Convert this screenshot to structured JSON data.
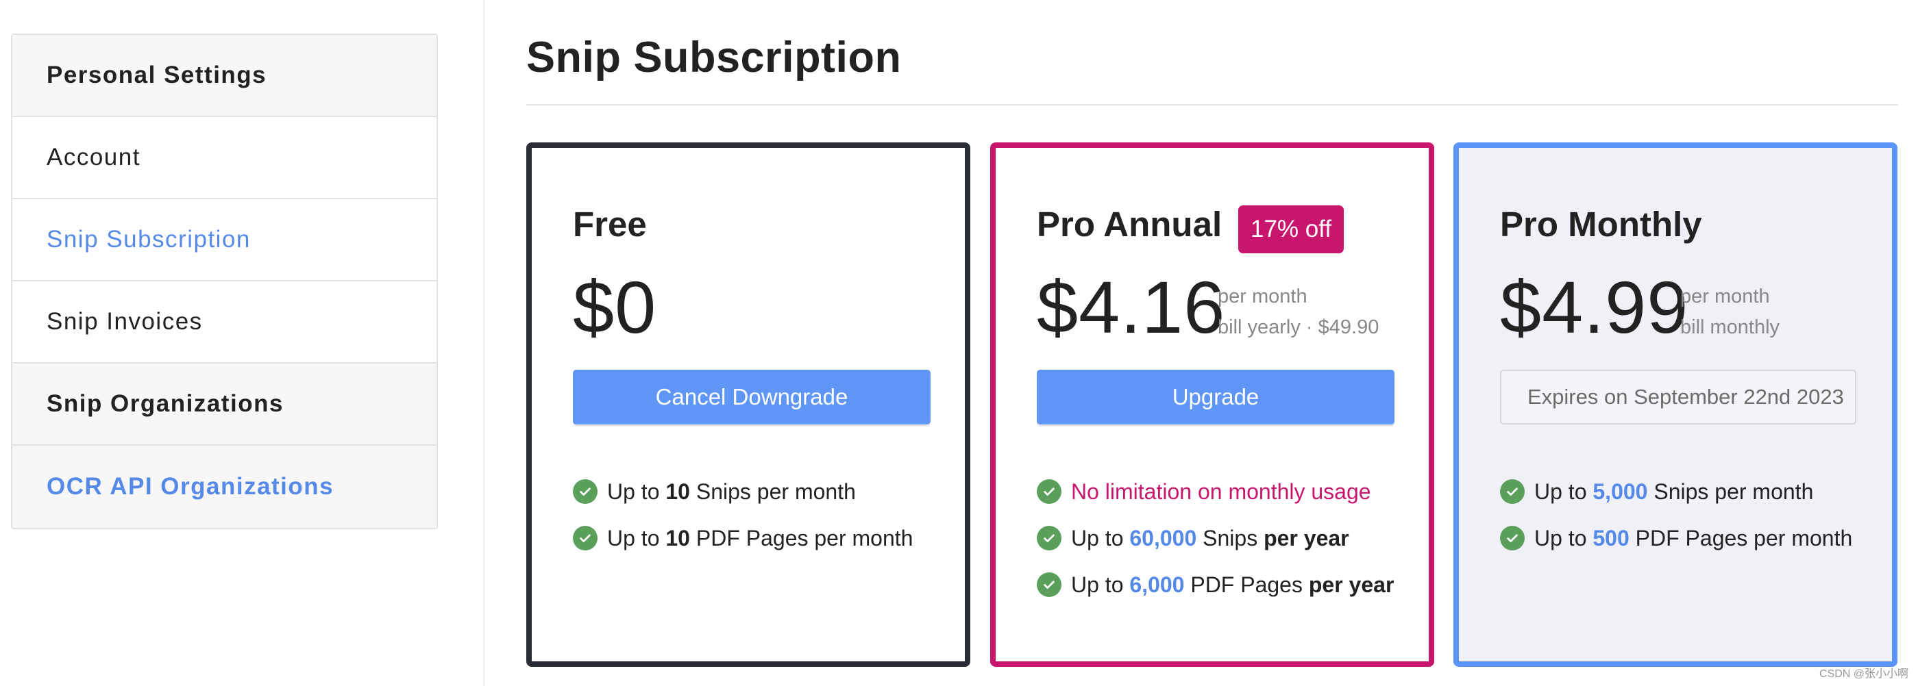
{
  "sidebar": {
    "items": [
      {
        "label": "Personal Settings"
      },
      {
        "label": "Account"
      },
      {
        "label": "Snip Subscription"
      },
      {
        "label": "Snip Invoices"
      },
      {
        "label": "Snip Organizations"
      },
      {
        "label": "OCR API Organizations"
      }
    ]
  },
  "main": {
    "title": "Snip Subscription"
  },
  "plans": {
    "free": {
      "name": "Free",
      "price": "$0",
      "button": "Cancel Downgrade",
      "features": [
        {
          "pre": "Up to ",
          "num": "10",
          "post": " Snips per month"
        },
        {
          "pre": "Up to ",
          "num": "10",
          "post": " PDF Pages per month"
        }
      ]
    },
    "annual": {
      "name": "Pro Annual",
      "badge": "17% off",
      "price": "$4.16",
      "note1": "per month",
      "note2": "bill yearly · $49.90",
      "button": "Upgrade",
      "features": [
        {
          "text": "No limitation on monthly usage"
        },
        {
          "pre": "Up to ",
          "num": "60,000",
          "mid": " Snips ",
          "bold": "per year"
        },
        {
          "pre": "Up to ",
          "num": "6,000",
          "mid": " PDF Pages ",
          "bold": "per year"
        }
      ]
    },
    "monthly": {
      "name": "Pro Monthly",
      "price": "$4.99",
      "note1": "per month",
      "note2": "bill monthly",
      "button": "Expires on September 22nd 2023",
      "features": [
        {
          "pre": "Up to ",
          "num": "5,000",
          "post": " Snips per month"
        },
        {
          "pre": "Up to ",
          "num": "500",
          "post": " PDF Pages per month"
        }
      ]
    }
  },
  "icons": {
    "feature_check": "check-circle-icon"
  },
  "colors": {
    "accent": "#5f96f6",
    "pink": "#c8166d",
    "dark_border": "#2b2d36",
    "check_green": "#5aa05b"
  },
  "watermark": "CSDN @张小小啊"
}
